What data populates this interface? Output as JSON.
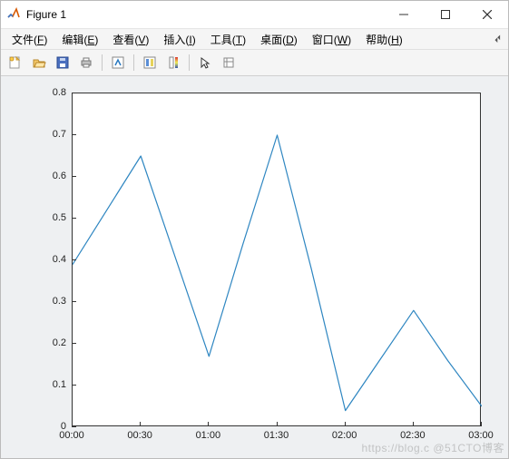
{
  "window": {
    "title": "Figure 1"
  },
  "menus": [
    {
      "label": "文件",
      "mnemonic": "F"
    },
    {
      "label": "编辑",
      "mnemonic": "E"
    },
    {
      "label": "查看",
      "mnemonic": "V"
    },
    {
      "label": "插入",
      "mnemonic": "I"
    },
    {
      "label": "工具",
      "mnemonic": "T"
    },
    {
      "label": "桌面",
      "mnemonic": "D"
    },
    {
      "label": "窗口",
      "mnemonic": "W"
    },
    {
      "label": "帮助",
      "mnemonic": "H"
    }
  ],
  "toolbar": [
    {
      "name": "new-figure-icon"
    },
    {
      "name": "open-icon"
    },
    {
      "name": "save-icon"
    },
    {
      "name": "print-icon"
    },
    {
      "sep": true
    },
    {
      "name": "link-icon"
    },
    {
      "sep": true
    },
    {
      "name": "data-cursor-icon"
    },
    {
      "name": "colorbar-icon"
    },
    {
      "sep": true
    },
    {
      "name": "pointer-icon"
    },
    {
      "name": "insert-icon"
    }
  ],
  "colors": {
    "line": "#2E86C1",
    "axes_bg": "#eef0f2",
    "plot_bg": "#ffffff",
    "axis": "#333333"
  },
  "watermark": "https://blog.c @51CTO博客",
  "chart_data": {
    "type": "line",
    "title": "",
    "xlabel": "",
    "ylabel": "",
    "x_tick_labels": [
      "00:00",
      "00:30",
      "01:00",
      "01:30",
      "02:00",
      "02:30",
      "03:00"
    ],
    "x_tick_positions": [
      0,
      0.5,
      1.0,
      1.5,
      2.0,
      2.5,
      3.0
    ],
    "y_ticks": [
      0,
      0.1,
      0.2,
      0.3,
      0.4,
      0.5,
      0.6,
      0.7,
      0.8
    ],
    "xlim": [
      0,
      3.0
    ],
    "ylim": [
      0,
      0.8
    ],
    "grid": false,
    "series": [
      {
        "name": "series1",
        "x": [
          0.0,
          0.25,
          0.5,
          0.75,
          1.0,
          1.25,
          1.5,
          1.75,
          2.0,
          2.25,
          2.5,
          2.75,
          3.0
        ],
        "y": [
          0.39,
          0.52,
          0.65,
          0.41,
          0.17,
          0.44,
          0.7,
          0.38,
          0.04,
          0.16,
          0.28,
          0.16,
          0.05
        ]
      }
    ]
  }
}
